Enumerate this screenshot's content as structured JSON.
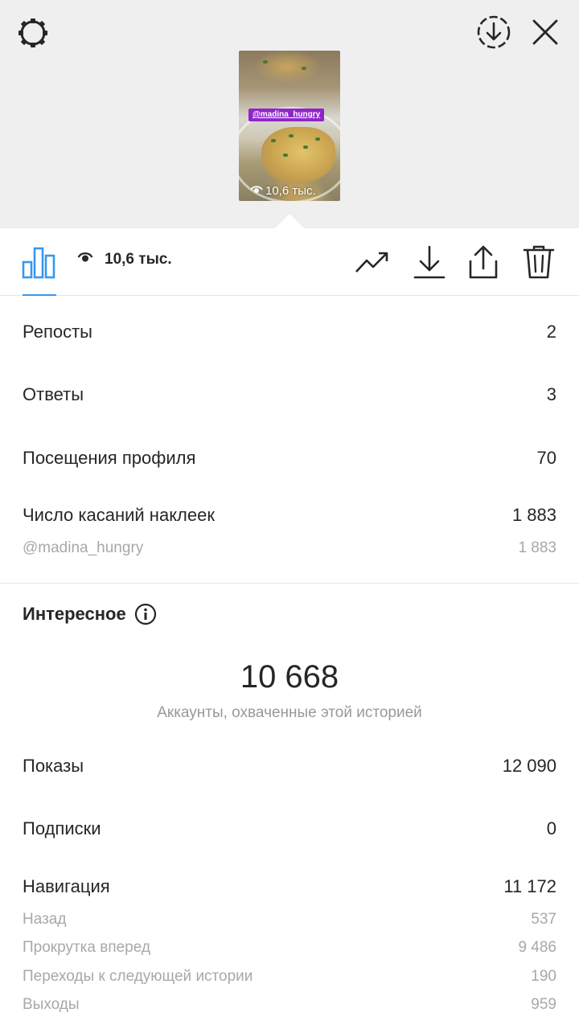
{
  "header": {
    "settings_icon": "gear-icon",
    "save_icon": "download-circle-icon",
    "close_icon": "close-icon"
  },
  "preview": {
    "mention_tag": "@madina_hungry",
    "views": "10,6 тыс.",
    "tag_color": "#8f26c9"
  },
  "toolbar": {
    "views": "10,6 тыс.",
    "accent_color": "#3897f0",
    "icons": [
      "bar-chart-icon",
      "eye-icon",
      "trending-icon",
      "download-icon",
      "share-icon",
      "trash-icon"
    ]
  },
  "metrics": {
    "reposts": {
      "label": "Репосты",
      "value": "2"
    },
    "replies": {
      "label": "Ответы",
      "value": "3"
    },
    "profile_visits": {
      "label": "Посещения профиля",
      "value": "70"
    },
    "sticker_taps": {
      "label": "Число касаний наклеек",
      "value": "1 883"
    },
    "sticker_mention": {
      "label": "@madina_hungry",
      "value": "1 883"
    }
  },
  "discovery": {
    "title": "Интересное",
    "reach_value": "10 668",
    "reach_caption": "Аккаунты, охваченные этой историей",
    "impressions": {
      "label": "Показы",
      "value": "12 090"
    },
    "follows": {
      "label": "Подписки",
      "value": "0"
    },
    "navigation": {
      "label": "Навигация",
      "value": "11 172"
    },
    "back": {
      "label": "Назад",
      "value": "537"
    },
    "forward": {
      "label": "Прокрутка вперед",
      "value": "9 486"
    },
    "next_story": {
      "label": "Переходы к следующей истории",
      "value": "190"
    },
    "exited": {
      "label": "Выходы",
      "value": "959"
    }
  }
}
